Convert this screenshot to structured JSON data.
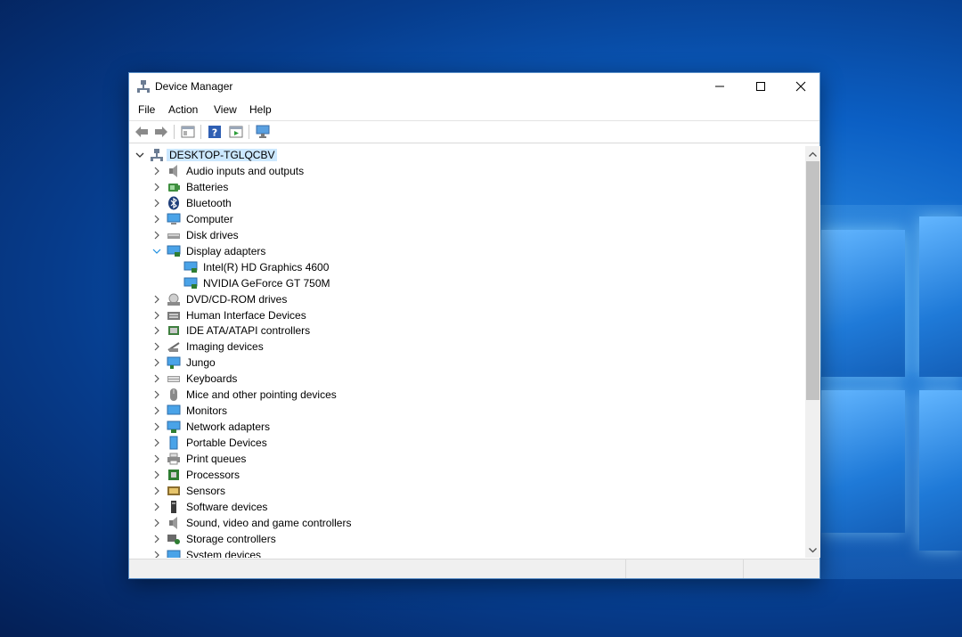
{
  "window": {
    "title": "Device Manager"
  },
  "menu": [
    "File",
    "Action",
    "View",
    "Help"
  ],
  "toolbar": {
    "buttons": [
      "back-arrow-icon",
      "forward-arrow-icon",
      "properties-icon",
      "help-icon",
      "update-driver-icon",
      "scan-hardware-icon"
    ]
  },
  "tree": {
    "root": "DESKTOP-TGLQCBV",
    "categories": [
      {
        "label": "Audio inputs and outputs",
        "icon": "speaker-icon",
        "expanded": false
      },
      {
        "label": "Batteries",
        "icon": "battery-icon",
        "expanded": false
      },
      {
        "label": "Bluetooth",
        "icon": "bluetooth-icon",
        "expanded": false
      },
      {
        "label": "Computer",
        "icon": "computer-icon",
        "expanded": false
      },
      {
        "label": "Disk drives",
        "icon": "disk-drive-icon",
        "expanded": false
      },
      {
        "label": "Display adapters",
        "icon": "display-adapter-icon",
        "expanded": true,
        "children": [
          "Intel(R) HD Graphics 4600",
          "NVIDIA GeForce GT 750M"
        ]
      },
      {
        "label": "DVD/CD-ROM drives",
        "icon": "dvd-drive-icon",
        "expanded": false
      },
      {
        "label": "Human Interface Devices",
        "icon": "hid-icon",
        "expanded": false
      },
      {
        "label": "IDE ATA/ATAPI controllers",
        "icon": "ide-controller-icon",
        "expanded": false
      },
      {
        "label": "Imaging devices",
        "icon": "camera-icon",
        "expanded": false
      },
      {
        "label": "Jungo",
        "icon": "jungo-icon",
        "expanded": false
      },
      {
        "label": "Keyboards",
        "icon": "keyboard-icon",
        "expanded": false
      },
      {
        "label": "Mice and other pointing devices",
        "icon": "mouse-icon",
        "expanded": false
      },
      {
        "label": "Monitors",
        "icon": "monitor-icon",
        "expanded": false
      },
      {
        "label": "Network adapters",
        "icon": "network-adapter-icon",
        "expanded": false
      },
      {
        "label": "Portable Devices",
        "icon": "portable-device-icon",
        "expanded": false
      },
      {
        "label": "Print queues",
        "icon": "printer-icon",
        "expanded": false
      },
      {
        "label": "Processors",
        "icon": "processor-icon",
        "expanded": false
      },
      {
        "label": "Sensors",
        "icon": "sensor-icon",
        "expanded": false
      },
      {
        "label": "Software devices",
        "icon": "software-device-icon",
        "expanded": false
      },
      {
        "label": "Sound, video and game controllers",
        "icon": "speaker-icon",
        "expanded": false
      },
      {
        "label": "Storage controllers",
        "icon": "storage-controller-icon",
        "expanded": false
      },
      {
        "label": "System devices",
        "icon": "system-device-icon",
        "expanded": false
      }
    ]
  },
  "colors": {
    "selection": "#cce8ff",
    "expand_chevron": "#1e90e0",
    "window_border": "#5a8fc7"
  }
}
